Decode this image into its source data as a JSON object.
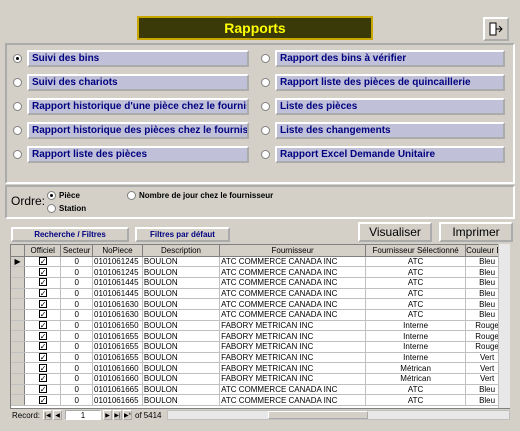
{
  "title": "Rapports",
  "reports_left": [
    {
      "label": "Suivi des bins",
      "selected": true
    },
    {
      "label": "Suivi des chariots",
      "selected": false
    },
    {
      "label": "Rapport historique d'une pièce chez le fournisseur",
      "selected": false
    },
    {
      "label": "Rapport historique des pièces chez le fournisseur",
      "selected": false
    },
    {
      "label": "Rapport liste des pièces",
      "selected": false
    }
  ],
  "reports_right": [
    {
      "label": "Rapport des bins à vérifier",
      "selected": false
    },
    {
      "label": "Rapport liste des pièces de quincaillerie",
      "selected": false
    },
    {
      "label": "Liste des pièces",
      "selected": false
    },
    {
      "label": "Liste des changements",
      "selected": false
    },
    {
      "label": "Rapport Excel Demande Unitaire",
      "selected": false
    }
  ],
  "ordre": {
    "label": "Ordre:",
    "options": {
      "piece": "Pièce",
      "station": "Station",
      "nb_jours": "Nombre de jour chez le fournisseur"
    },
    "selected": "piece"
  },
  "buttons": {
    "recherche": "Recherche / Filtres",
    "filtres_defaut": "Filtres par défaut",
    "visualiser": "Visualiser",
    "imprimer": "Imprimer"
  },
  "table": {
    "columns": [
      "Officiel",
      "Secteur",
      "NoPiece",
      "Description",
      "Fournisseur",
      "Fournisseur Sélectionné",
      "Couleur Bin"
    ],
    "rows": [
      [
        "✓",
        "0",
        "0101061245",
        "BOULON",
        "ATC COMMERCE CANADA INC",
        "ATC",
        "Bleu"
      ],
      [
        "✓",
        "0",
        "0101061245",
        "BOULON",
        "ATC COMMERCE CANADA INC",
        "ATC",
        "Bleu"
      ],
      [
        "✓",
        "0",
        "0101061445",
        "BOULON",
        "ATC COMMERCE CANADA INC",
        "ATC",
        "Bleu"
      ],
      [
        "✓",
        "0",
        "0101061445",
        "BOULON",
        "ATC COMMERCE CANADA INC",
        "ATC",
        "Bleu"
      ],
      [
        "✓",
        "0",
        "0101061630",
        "BOULON",
        "ATC COMMERCE CANADA INC",
        "ATC",
        "Bleu"
      ],
      [
        "✓",
        "0",
        "0101061630",
        "BOULON",
        "ATC COMMERCE CANADA INC",
        "ATC",
        "Bleu"
      ],
      [
        "✓",
        "0",
        "0101061650",
        "BOULON",
        "FABORY METRICAN INC",
        "Interne",
        "Rouge"
      ],
      [
        "✓",
        "0",
        "0101061655",
        "BOULON",
        "FABORY METRICAN INC",
        "Interne",
        "Rouge"
      ],
      [
        "✓",
        "0",
        "0101061655",
        "BOULON",
        "FABORY METRICAN INC",
        "Interne",
        "Rouge"
      ],
      [
        "✓",
        "0",
        "0101061655",
        "BOULON",
        "FABORY METRICAN INC",
        "Interne",
        "Vert"
      ],
      [
        "✓",
        "0",
        "0101061660",
        "BOULON",
        "FABORY METRICAN INC",
        "Métrican",
        "Vert"
      ],
      [
        "✓",
        "0",
        "0101061660",
        "BOULON",
        "FABORY METRICAN INC",
        "Métrican",
        "Vert"
      ],
      [
        "✓",
        "0",
        "0101061665",
        "BOULON",
        "ATC COMMERCE CANADA INC",
        "ATC",
        "Bleu"
      ],
      [
        "✓",
        "0",
        "0101061665",
        "BOULON",
        "ATC COMMERCE CANADA INC",
        "ATC",
        "Bleu"
      ]
    ]
  },
  "nav": {
    "record_label": "Record:",
    "current": "1",
    "of_label": "of",
    "total": "5414"
  }
}
